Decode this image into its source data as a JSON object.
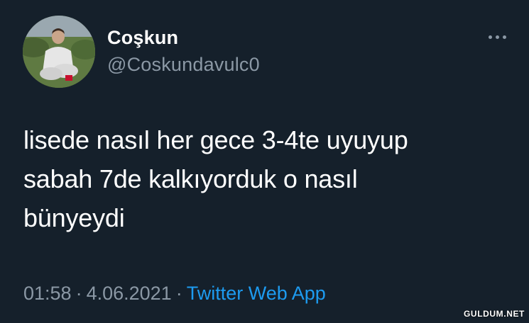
{
  "tweet": {
    "display_name": "Coşkun",
    "handle": "@Coskundavulc0",
    "text": "lisede nasıl her gece 3-4te uyuyup\nsabah 7de kalkıyorduk o nasıl\nbünyeydi",
    "time": "01:58",
    "date": "4.06.2021",
    "separator": "·",
    "source": "Twitter Web App"
  },
  "watermark": "GULDUM.NET",
  "colors": {
    "background": "#15202b",
    "primary_text": "#ffffff",
    "secondary_text": "#8b98a5",
    "link": "#1d9bf0"
  },
  "icons": {
    "more": "more-horizontal-icon"
  }
}
